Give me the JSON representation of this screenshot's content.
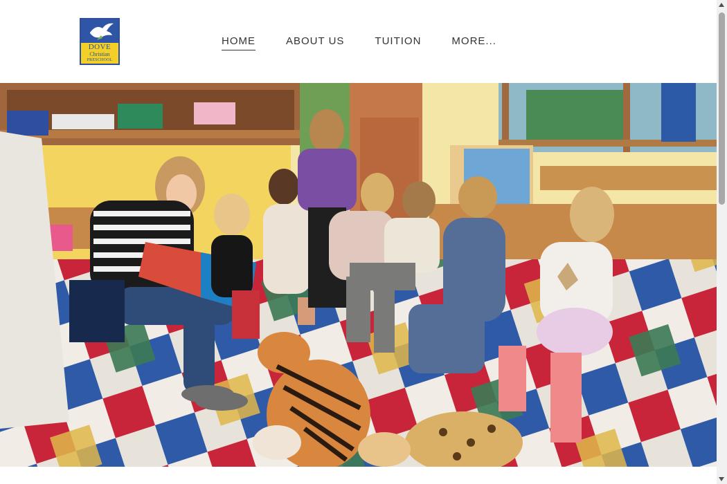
{
  "logo": {
    "line1": "DOVE",
    "line2": "Christian",
    "line3": "PRESCHOOL",
    "colors": {
      "background": "#f2d027",
      "top": "#2f55a6",
      "text": "#2f4f9a"
    }
  },
  "nav": {
    "items": [
      {
        "label": "HOME",
        "active": true
      },
      {
        "label": "ABOUT US",
        "active": false
      },
      {
        "label": "TUITION",
        "active": false
      },
      {
        "label": "MORE...",
        "active": false
      }
    ]
  },
  "hero": {
    "subject": "classroom-storytime-photo"
  }
}
